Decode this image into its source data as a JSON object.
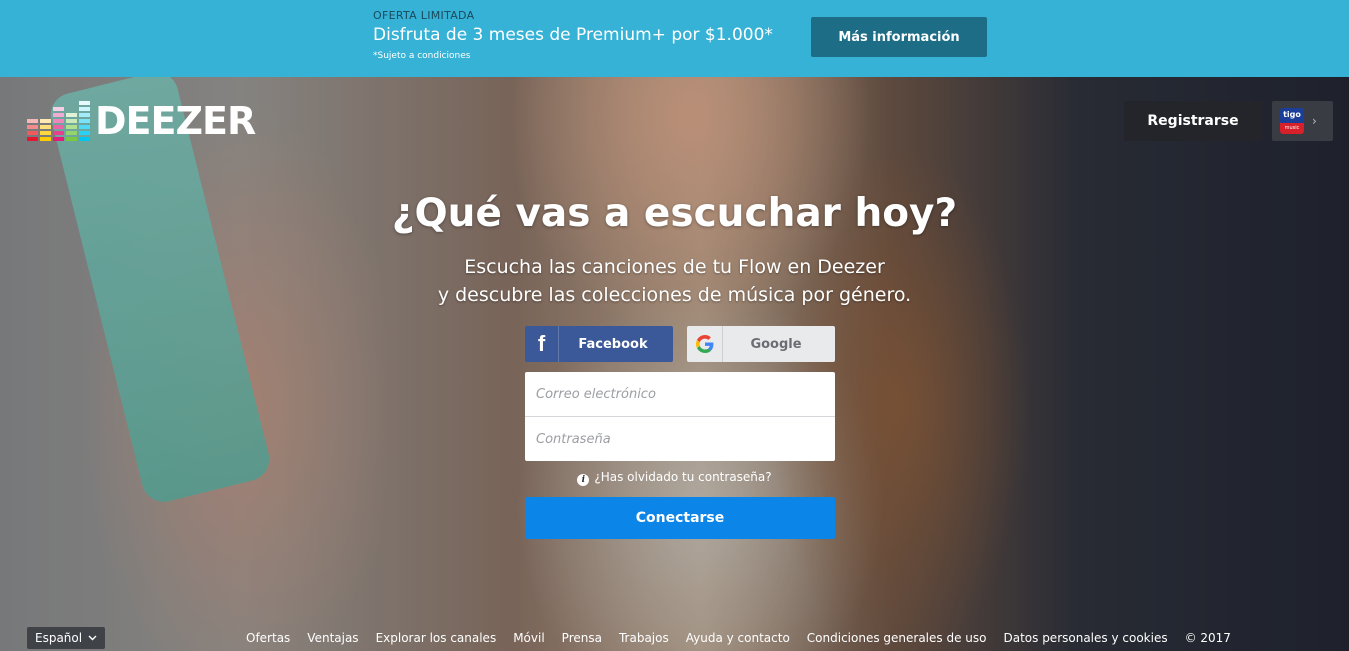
{
  "promo": {
    "kicker": "OFERTA LIMITADA",
    "headline": "Disfruta de 3 meses de Premium+ por $1.000*",
    "note": "*Sujeto a condiciones",
    "cta_label": "Más información",
    "background_color": "#35b2d6",
    "cta_color": "#1e6d87"
  },
  "header": {
    "logo_text": "DEEZER",
    "register_label": "Registrarse",
    "partner": {
      "badge_top": "tigo",
      "badge_bottom": "music",
      "chevron": "›"
    }
  },
  "hero": {
    "title": "¿Qué vas a escuchar hoy?",
    "subtitle_line1": "Escucha las canciones de tu Flow en Deezer",
    "subtitle_line2": "y descubre las colecciones de música por género."
  },
  "login": {
    "facebook_label": "Facebook",
    "google_label": "Google",
    "email_placeholder": "Correo electrónico",
    "password_placeholder": "Contraseña",
    "forgot_label": "¿Has olvidado tu contraseña?",
    "submit_label": "Conectarse",
    "submit_color": "#0c85e8",
    "facebook_color": "#3b5998"
  },
  "footer": {
    "language": "Español",
    "links": [
      "Ofertas",
      "Ventajas",
      "Explorar los canales",
      "Móvil",
      "Prensa",
      "Trabajos",
      "Ayuda y contacto",
      "Condiciones generales de uso",
      "Datos personales y cookies"
    ],
    "copyright": "© 2017"
  },
  "icons": {
    "logo_equalizer": "deezer-equalizer-icon",
    "facebook": "facebook-icon",
    "google": "google-icon",
    "info": "info-icon",
    "language_dropdown": "chevron-down-icon",
    "partner_chevron": "chevron-right-icon"
  }
}
